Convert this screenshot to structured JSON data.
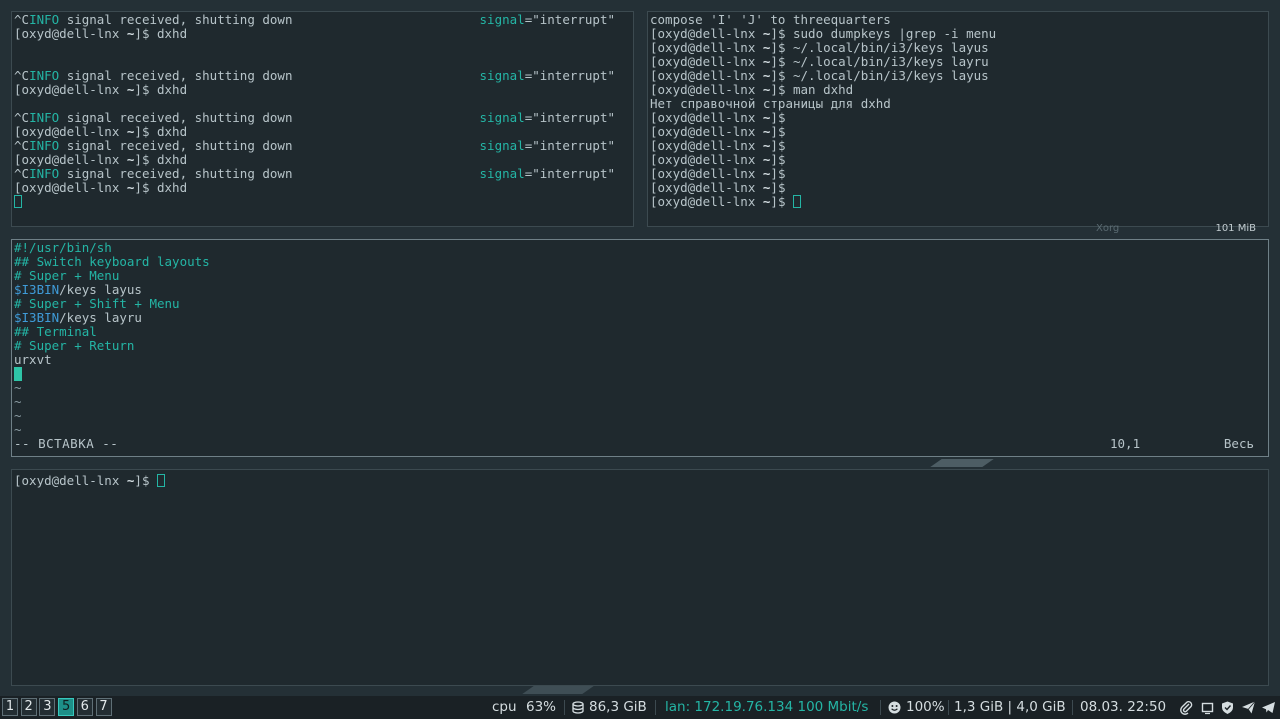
{
  "panes": {
    "top_left": {
      "lines": [
        [
          {
            "t": "^C",
            "c": "t-norm"
          },
          {
            "t": "INFO",
            "c": "t-cyan"
          },
          {
            "t": " signal received, shutting down",
            "c": "t-norm"
          },
          {
            "t": "signal",
            "c": "t-cyan",
            "right": true,
            "rest": "=\"interrupt\""
          }
        ],
        [
          {
            "t": "[oxyd@dell-lnx ",
            "c": "t-norm"
          },
          {
            "t": "~",
            "c": "t-bold"
          },
          {
            "t": "]$ dxhd",
            "c": "t-norm"
          }
        ],
        [],
        [],
        [
          {
            "t": "^C",
            "c": "t-norm"
          },
          {
            "t": "INFO",
            "c": "t-cyan"
          },
          {
            "t": " signal received, shutting down",
            "c": "t-norm"
          },
          {
            "t": "signal",
            "c": "t-cyan",
            "right": true,
            "rest": "=\"interrupt\""
          }
        ],
        [
          {
            "t": "[oxyd@dell-lnx ",
            "c": "t-norm"
          },
          {
            "t": "~",
            "c": "t-bold"
          },
          {
            "t": "]$ dxhd",
            "c": "t-norm"
          }
        ],
        [],
        [
          {
            "t": "^C",
            "c": "t-norm"
          },
          {
            "t": "INFO",
            "c": "t-cyan"
          },
          {
            "t": " signal received, shutting down",
            "c": "t-norm"
          },
          {
            "t": "signal",
            "c": "t-cyan",
            "right": true,
            "rest": "=\"interrupt\""
          }
        ],
        [
          {
            "t": "[oxyd@dell-lnx ",
            "c": "t-norm"
          },
          {
            "t": "~",
            "c": "t-bold"
          },
          {
            "t": "]$ dxhd",
            "c": "t-norm"
          }
        ],
        [
          {
            "t": "^C",
            "c": "t-norm"
          },
          {
            "t": "INFO",
            "c": "t-cyan"
          },
          {
            "t": " signal received, shutting down",
            "c": "t-norm"
          },
          {
            "t": "signal",
            "c": "t-cyan",
            "right": true,
            "rest": "=\"interrupt\""
          }
        ],
        [
          {
            "t": "[oxyd@dell-lnx ",
            "c": "t-norm"
          },
          {
            "t": "~",
            "c": "t-bold"
          },
          {
            "t": "]$ dxhd",
            "c": "t-norm"
          }
        ],
        [
          {
            "t": "^C",
            "c": "t-norm"
          },
          {
            "t": "INFO",
            "c": "t-cyan"
          },
          {
            "t": " signal received, shutting down",
            "c": "t-norm"
          },
          {
            "t": "signal",
            "c": "t-cyan",
            "right": true,
            "rest": "=\"interrupt\""
          }
        ],
        [
          {
            "t": "[oxyd@dell-lnx ",
            "c": "t-norm"
          },
          {
            "t": "~",
            "c": "t-bold"
          },
          {
            "t": "]$ dxhd",
            "c": "t-norm"
          }
        ],
        [
          {
            "cursor": "empty"
          }
        ]
      ]
    },
    "top_right": {
      "lines": [
        [
          {
            "t": "compose 'I' 'J' to threequarters",
            "c": "t-norm"
          }
        ],
        [
          {
            "t": "[oxyd@dell-lnx ",
            "c": "t-norm"
          },
          {
            "t": "~",
            "c": "t-bold"
          },
          {
            "t": "]$ sudo dumpkeys |grep -i menu",
            "c": "t-norm"
          }
        ],
        [
          {
            "t": "[oxyd@dell-lnx ",
            "c": "t-norm"
          },
          {
            "t": "~",
            "c": "t-bold"
          },
          {
            "t": "]$ ~/.local/bin/i3/keys layus",
            "c": "t-norm"
          }
        ],
        [
          {
            "t": "[oxyd@dell-lnx ",
            "c": "t-norm"
          },
          {
            "t": "~",
            "c": "t-bold"
          },
          {
            "t": "]$ ~/.local/bin/i3/keys layru",
            "c": "t-norm"
          }
        ],
        [
          {
            "t": "[oxyd@dell-lnx ",
            "c": "t-norm"
          },
          {
            "t": "~",
            "c": "t-bold"
          },
          {
            "t": "]$ ~/.local/bin/i3/keys layus",
            "c": "t-norm"
          }
        ],
        [
          {
            "t": "[oxyd@dell-lnx ",
            "c": "t-norm"
          },
          {
            "t": "~",
            "c": "t-bold"
          },
          {
            "t": "]$ man dxhd",
            "c": "t-norm"
          }
        ],
        [
          {
            "t": "Нет справочной страницы для dxhd",
            "c": "t-norm"
          }
        ],
        [
          {
            "t": "[oxyd@dell-lnx ",
            "c": "t-norm"
          },
          {
            "t": "~",
            "c": "t-bold"
          },
          {
            "t": "]$",
            "c": "t-norm"
          }
        ],
        [
          {
            "t": "[oxyd@dell-lnx ",
            "c": "t-norm"
          },
          {
            "t": "~",
            "c": "t-bold"
          },
          {
            "t": "]$",
            "c": "t-norm"
          }
        ],
        [
          {
            "t": "[oxyd@dell-lnx ",
            "c": "t-norm"
          },
          {
            "t": "~",
            "c": "t-bold"
          },
          {
            "t": "]$",
            "c": "t-norm"
          }
        ],
        [
          {
            "t": "[oxyd@dell-lnx ",
            "c": "t-norm"
          },
          {
            "t": "~",
            "c": "t-bold"
          },
          {
            "t": "]$",
            "c": "t-norm"
          }
        ],
        [
          {
            "t": "[oxyd@dell-lnx ",
            "c": "t-norm"
          },
          {
            "t": "~",
            "c": "t-bold"
          },
          {
            "t": "]$",
            "c": "t-norm"
          }
        ],
        [
          {
            "t": "[oxyd@dell-lnx ",
            "c": "t-norm"
          },
          {
            "t": "~",
            "c": "t-bold"
          },
          {
            "t": "]$",
            "c": "t-norm"
          }
        ],
        [
          {
            "t": "[oxyd@dell-lnx ",
            "c": "t-norm"
          },
          {
            "t": "~",
            "c": "t-bold"
          },
          {
            "t": "]$ ",
            "c": "t-norm"
          },
          {
            "cursor": "empty"
          }
        ]
      ]
    },
    "editor": {
      "lines": [
        [
          {
            "t": "#!/usr/bin/sh",
            "c": "t-cyan"
          }
        ],
        [
          {
            "t": "## Switch keyboard layouts",
            "c": "t-cyan"
          }
        ],
        [
          {
            "t": "# Super + Menu",
            "c": "t-cyan"
          }
        ],
        [
          {
            "t": "$I3BIN",
            "c": "t-blue"
          },
          {
            "t": "/keys layus",
            "c": "t-norm"
          }
        ],
        [
          {
            "t": "# Super + Shift + Menu",
            "c": "t-cyan"
          }
        ],
        [
          {
            "t": "$I3BIN",
            "c": "t-blue"
          },
          {
            "t": "/keys layru",
            "c": "t-norm"
          }
        ],
        [
          {
            "t": "## Terminal",
            "c": "t-cyan"
          }
        ],
        [
          {
            "t": "# Super + Return",
            "c": "t-cyan"
          }
        ],
        [
          {
            "t": "urxvt",
            "c": "t-norm"
          }
        ],
        [
          {
            "cursor": "block"
          }
        ],
        [
          {
            "t": "~",
            "c": "t-muted"
          }
        ],
        [
          {
            "t": "~",
            "c": "t-muted"
          }
        ],
        [
          {
            "t": "~",
            "c": "t-muted"
          }
        ],
        [
          {
            "t": "~",
            "c": "t-muted"
          }
        ]
      ],
      "status": {
        "mode": "-- ВСТАВКА --",
        "position": "10,1",
        "scroll": "Весь"
      }
    },
    "bottom": {
      "lines": [
        [
          {
            "t": "[oxyd@dell-lnx ",
            "c": "t-norm"
          },
          {
            "t": "~",
            "c": "t-bold"
          },
          {
            "t": "]$ ",
            "c": "t-norm"
          },
          {
            "cursor": "empty"
          }
        ]
      ]
    }
  },
  "floating": {
    "label": "Xorg",
    "memory": "101 MiB"
  },
  "bar": {
    "workspaces": [
      {
        "label": "1",
        "active": false
      },
      {
        "label": "2",
        "active": false
      },
      {
        "label": "3",
        "active": false
      },
      {
        "label": "5",
        "active": true
      },
      {
        "label": "6",
        "active": false
      },
      {
        "label": "7",
        "active": false
      }
    ],
    "cpu_label": "cpu",
    "cpu_value": "63%",
    "disk": "86,3 GiB",
    "lan": "lan: 172.19.76.134 100 Mbit/s",
    "battery": "100%",
    "memory": "1,3 GiB | 4,0 GiB",
    "clock": "08.03. 22:50",
    "tray_icons": [
      "paperclip-icon",
      "window-icon",
      "shield-icon",
      "send-icon",
      "telegram-icon"
    ],
    "colors": {
      "accent": "#24b5a5",
      "active_ws": "#1d8f88"
    }
  }
}
